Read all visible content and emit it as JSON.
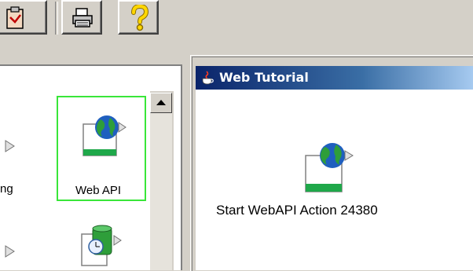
{
  "toolbar": {
    "buttons": [
      {
        "icon": "clipboard-icon"
      },
      {
        "icon": "printer-icon"
      },
      {
        "icon": "help-question-icon"
      }
    ]
  },
  "palette": {
    "items": [
      {
        "label": "ng",
        "icon": "web-action-icon"
      },
      {
        "label": "Web API",
        "icon": "web-action-icon",
        "selected": true
      },
      {
        "label": "",
        "icon": "web-action-icon"
      },
      {
        "label": "",
        "icon": "database-clock-icon"
      }
    ]
  },
  "window": {
    "title": "Web Tutorial",
    "node_label": "Start WebAPI Action 24380"
  },
  "colors": {
    "selection": "#39e639",
    "titlebar_start": "#0a246a",
    "titlebar_end": "#a6caf0"
  }
}
